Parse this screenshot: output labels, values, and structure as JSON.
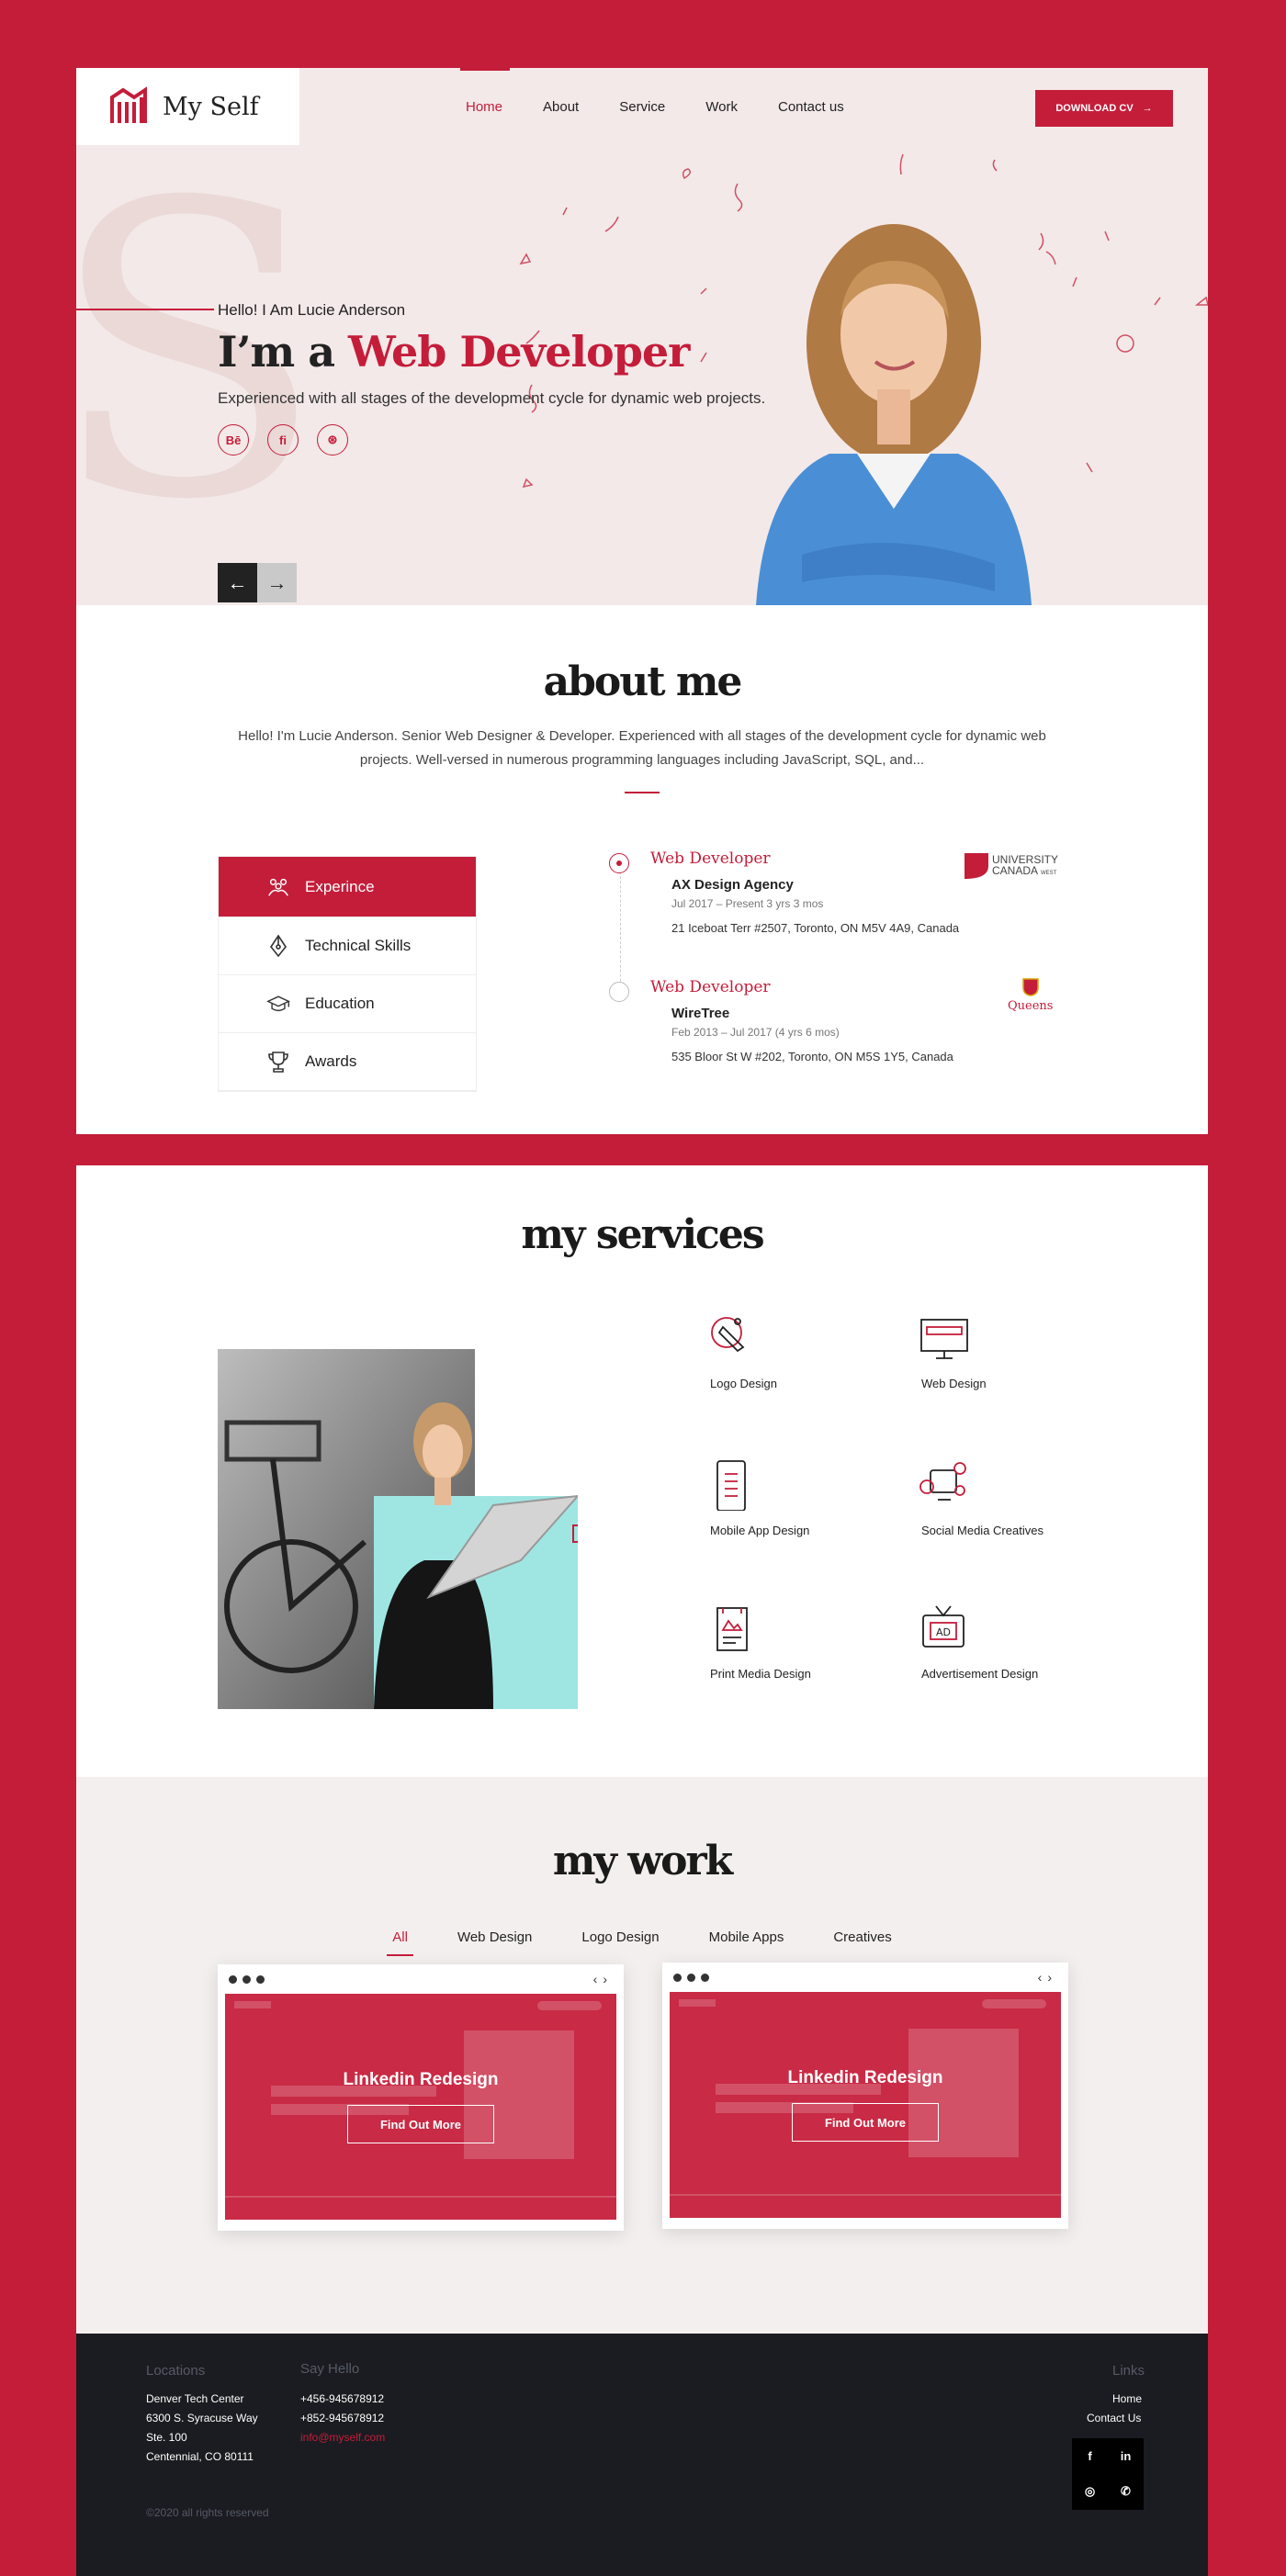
{
  "header": {
    "logo_text": "My Self",
    "nav": [
      "Home",
      "About",
      "Service",
      "Work",
      "Contact us"
    ],
    "download_label": "DOWNLOAD CV"
  },
  "hero": {
    "hello": "Hello! I Am Lucie Anderson",
    "title_prefix": "I’m a ",
    "title_accent": "Web Developer",
    "subtitle": "Experienced with all stages of the development cycle for dynamic web projects.",
    "social": [
      "Bē",
      "fi",
      "⊛"
    ]
  },
  "about": {
    "title": "about me",
    "description": "Hello! I'm Lucie Anderson. Senior Web Designer & Developer. Experienced with all stages of the development cycle for dynamic web projects. Well-versed in numerous programming languages including JavaScript, SQL, and...",
    "tabs": [
      "Experince",
      "Technical Skills",
      "Education",
      "Awards"
    ],
    "timeline": [
      {
        "role": "Web Developer",
        "company": "AX Design Agency",
        "dates": "Jul 2017 – Present 3 yrs 3 mos",
        "address": "21 Iceboat Terr #2507, Toronto, ON M5V 4A9, Canada",
        "logo_line1": "UNIVERSITY",
        "logo_line2": "CANADA",
        "logo_line3": "WEST"
      },
      {
        "role": "Web Developer",
        "company": "WireTree",
        "dates": "Feb 2013 – Jul 2017 (4 yrs 6 mos)",
        "address": "535 Bloor St W #202, Toronto, ON M5S 1Y5, Canada",
        "logo_line1": "Queens"
      }
    ]
  },
  "services": {
    "title": "my services",
    "items": [
      "Logo Design",
      "Web Design",
      "Mobile App Design",
      "Social Media Creatives",
      "Print Media Design",
      "Advertisement Design"
    ]
  },
  "work": {
    "title": "my work",
    "filters": [
      "All",
      "Web Design",
      "Logo Design",
      "Mobile Apps",
      "Creatives"
    ],
    "cards": [
      {
        "title": "Linkedin Redesign",
        "button": "Find Out More"
      },
      {
        "title": "Linkedin Redesign",
        "button": "Find Out More"
      }
    ]
  },
  "footer": {
    "locations_head": "Locations",
    "locations": [
      "Denver Tech Center",
      "6300 S. Syracuse Way",
      "Ste. 100",
      "Centennial, CO 80111"
    ],
    "say_hello_head": "Say Hello",
    "phones": [
      "+456-945678912",
      "+852-945678912"
    ],
    "email": "info@myself.com",
    "links_head": "Links",
    "links": [
      "Home",
      "Contact Us"
    ],
    "social": [
      "f",
      "in",
      "◎",
      "✆"
    ],
    "copyright": "©2020 all rights reserved"
  },
  "colors": {
    "accent": "#c41d3a",
    "hero_bg": "#f3e9e8",
    "work_bg": "#f4efef",
    "footer_bg": "#1b1c21"
  }
}
